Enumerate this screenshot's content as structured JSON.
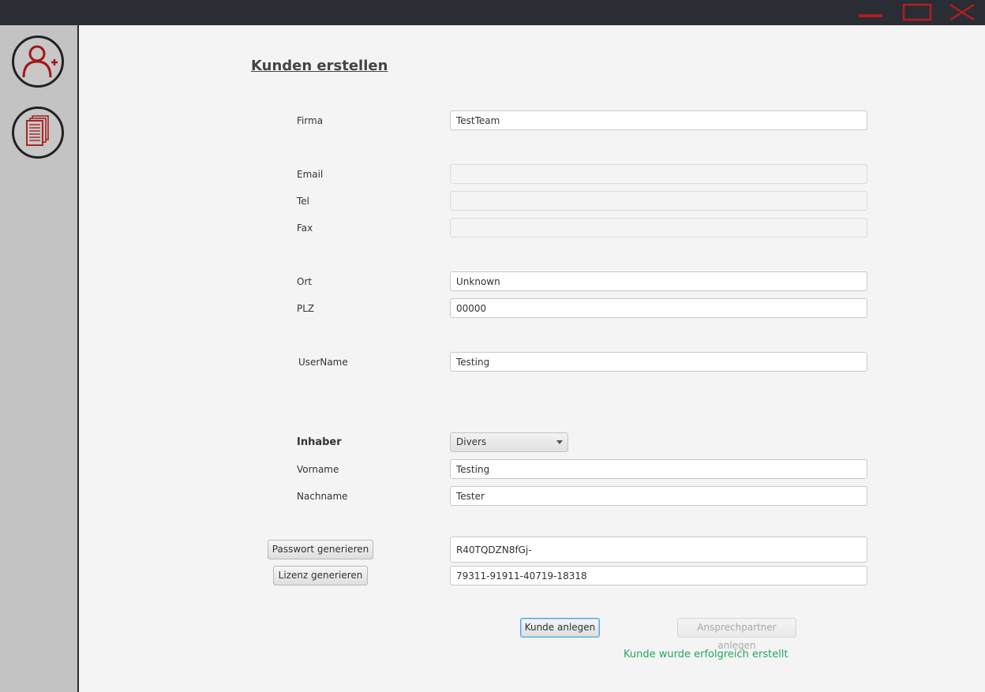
{
  "window": {
    "controls": {
      "minimize_icon": "minimize-icon",
      "maximize_icon": "maximize-icon",
      "close_icon": "close-icon"
    },
    "accent_color": "#b01e1e"
  },
  "sidebar": {
    "items": [
      {
        "icon": "add-user-icon"
      },
      {
        "icon": "documents-icon"
      }
    ]
  },
  "form": {
    "title": "Kunden erstellen",
    "firma": {
      "label": "Firma",
      "value": "TestTeam"
    },
    "email": {
      "label": "Email",
      "value": ""
    },
    "tel": {
      "label": "Tel",
      "value": ""
    },
    "fax": {
      "label": "Fax",
      "value": ""
    },
    "ort": {
      "label": "Ort",
      "value": "Unknown"
    },
    "plz": {
      "label": "PLZ",
      "value": "00000"
    },
    "username": {
      "label": "UserName",
      "value": "Testing"
    },
    "inhaber": {
      "label": "Inhaber",
      "selected": "Divers"
    },
    "vorname": {
      "label": "Vorname",
      "value": "Testing"
    },
    "nachname": {
      "label": "Nachname",
      "value": "Tester"
    },
    "password": {
      "button_label": "Passwort generieren",
      "value": "R40TQDZN8fGj-"
    },
    "license": {
      "button_label": "Lizenz generieren",
      "value": "79311-91911-40719-18318"
    },
    "create_button": "Kunde anlegen",
    "contact_button": "Ansprechpartner anlegen",
    "status_message": "Kunde wurde erfolgreich erstellt",
    "status_color": "#22a85a"
  }
}
